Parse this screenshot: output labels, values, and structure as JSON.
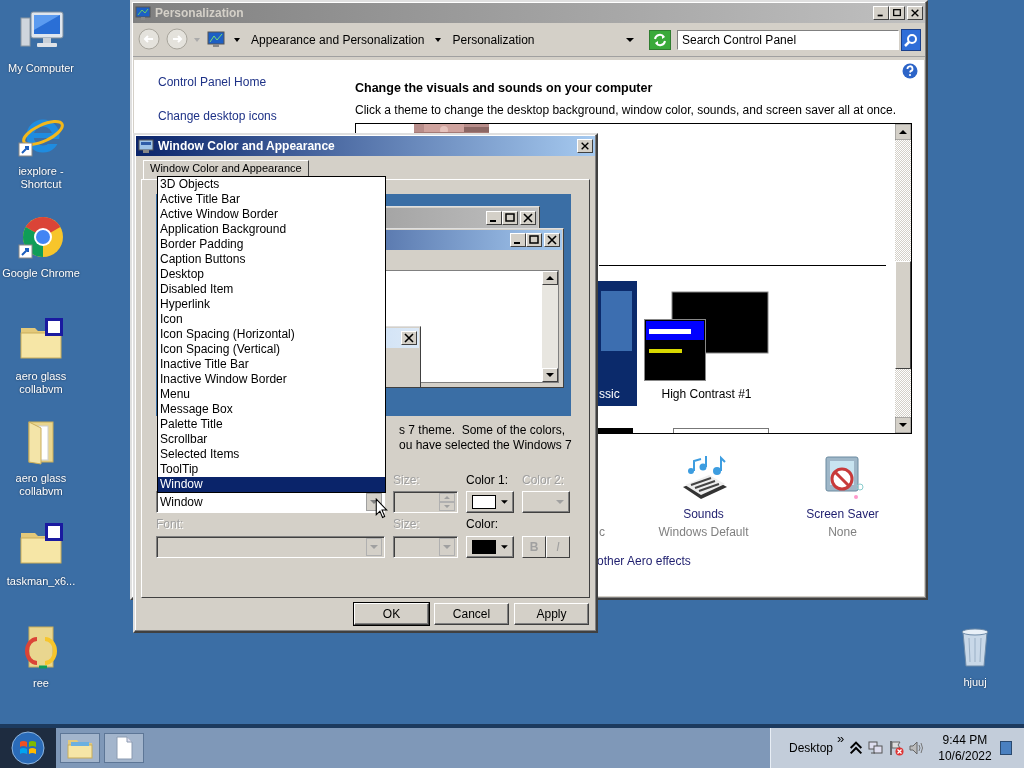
{
  "desktop": {
    "icons": [
      {
        "label": "My Computer",
        "kind": "computer",
        "shortcut": false
      },
      {
        "label": "iexplore - Shortcut",
        "kind": "ie",
        "shortcut": true
      },
      {
        "label": "Google Chrome",
        "kind": "chrome",
        "shortcut": true
      },
      {
        "label": "aero glass collabvm",
        "kind": "archive",
        "shortcut": false
      },
      {
        "label": "aero glass collabvm",
        "kind": "folder",
        "shortcut": false
      },
      {
        "label": "taskman_x6...",
        "kind": "archive",
        "shortcut": false
      },
      {
        "label": "ree",
        "kind": "colorfolder",
        "shortcut": false
      }
    ],
    "recycle_bin": {
      "label": "hjuuj"
    }
  },
  "personalization_window": {
    "title": "Personalization",
    "active": false,
    "breadcrumbs": [
      "Appearance and Personalization",
      "Personalization"
    ],
    "search": {
      "placeholder": "Search Control Panel"
    },
    "sidebar_links": [
      "Control Panel Home",
      "Change desktop icons"
    ],
    "heading": "Change the visuals and sounds on your computer",
    "description": "Click a theme to change the desktop background, window color, sounds, and screen saver all at once.",
    "themes": [
      {
        "label": "ssic",
        "kind": "classic",
        "selected": true
      },
      {
        "label": "High Contrast #1",
        "kind": "high_contrast",
        "selected": false
      }
    ],
    "settings": [
      {
        "kind": "window_color",
        "value": "c"
      },
      {
        "kind": "sounds",
        "label": "Sounds",
        "value": "Windows Default"
      },
      {
        "kind": "screen_saver",
        "label": "Screen Saver",
        "value": "None"
      }
    ],
    "link": "other Aero effects"
  },
  "dialog": {
    "title": "Window Color and Appearance",
    "active": true,
    "tabs": [
      {
        "label": "Window Color and Appearance",
        "selected": true
      }
    ],
    "item_list": [
      {
        "label": "3D Objects",
        "selected": false
      },
      {
        "label": "Active Title Bar",
        "selected": false
      },
      {
        "label": "Active Window Border",
        "selected": false
      },
      {
        "label": "Application Background",
        "selected": false
      },
      {
        "label": "Border Padding",
        "selected": false
      },
      {
        "label": "Caption Buttons",
        "selected": false
      },
      {
        "label": "Desktop",
        "selected": false
      },
      {
        "label": "Disabled Item",
        "selected": false
      },
      {
        "label": "Hyperlink",
        "selected": false
      },
      {
        "label": "Icon",
        "selected": false
      },
      {
        "label": "Icon Spacing (Horizontal)",
        "selected": false
      },
      {
        "label": "Icon Spacing (Vertical)",
        "selected": false
      },
      {
        "label": "Inactive Title Bar",
        "selected": false
      },
      {
        "label": "Inactive Window Border",
        "selected": false
      },
      {
        "label": "Menu",
        "selected": false
      },
      {
        "label": "Message Box",
        "selected": false
      },
      {
        "label": "Palette Title",
        "selected": false
      },
      {
        "label": "Scrollbar",
        "selected": false
      },
      {
        "label": "Selected Items",
        "selected": false
      },
      {
        "label": "ToolTip",
        "selected": false
      },
      {
        "label": "Window",
        "selected": true
      }
    ],
    "note_lines": [
      "s 7 theme.  Some of the colors,",
      "ou have selected the Windows 7"
    ],
    "item": {
      "value": "Window",
      "size_label": "Size:",
      "size_disabled": true
    },
    "font": {
      "label": "Font:",
      "disabled": true,
      "size_label": "Size:",
      "bold": "B",
      "italic": "I"
    },
    "color_buttons": [
      {
        "label": "Color 1:",
        "color": "#ffffff",
        "disabled": false
      },
      {
        "label": "Color 2:",
        "disabled": true
      },
      {
        "label": "Color:",
        "color": "#000000",
        "disabled": false
      }
    ],
    "buttons": [
      {
        "label": "OK",
        "default": true
      },
      {
        "label": "Cancel",
        "default": false
      },
      {
        "label": "Apply",
        "default": false
      }
    ]
  },
  "taskbar": {
    "pinned": [
      {
        "kind": "folder"
      },
      {
        "kind": "document"
      }
    ],
    "toolbar_label": "Desktop",
    "chevron": "»",
    "time": "9:44 PM",
    "date": "10/6/2022"
  }
}
